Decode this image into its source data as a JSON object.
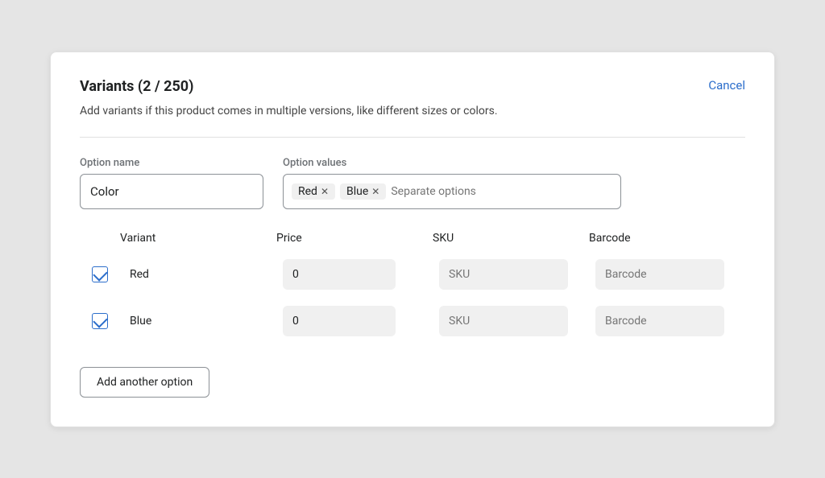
{
  "modal": {
    "title": "Variants (2 / 250)",
    "description": "Add variants if this product comes in multiple versions, like different sizes or colors.",
    "cancel_label": "Cancel"
  },
  "option_section": {
    "name_label": "Option name",
    "name_value": "Color",
    "values_label": "Option values",
    "values_placeholder": "Separate options",
    "tags": [
      {
        "label": "Red",
        "id": "tag-red"
      },
      {
        "label": "Blue",
        "id": "tag-blue"
      }
    ]
  },
  "table": {
    "headers": {
      "variant": "Variant",
      "price": "Price",
      "sku": "SKU",
      "barcode": "Barcode"
    },
    "rows": [
      {
        "checked": true,
        "name": "Red",
        "price": "0",
        "sku_placeholder": "SKU",
        "barcode_placeholder": "Barcode"
      },
      {
        "checked": true,
        "name": "Blue",
        "price": "0",
        "sku_placeholder": "SKU",
        "barcode_placeholder": "Barcode"
      }
    ]
  },
  "add_option_button": "Add another option"
}
